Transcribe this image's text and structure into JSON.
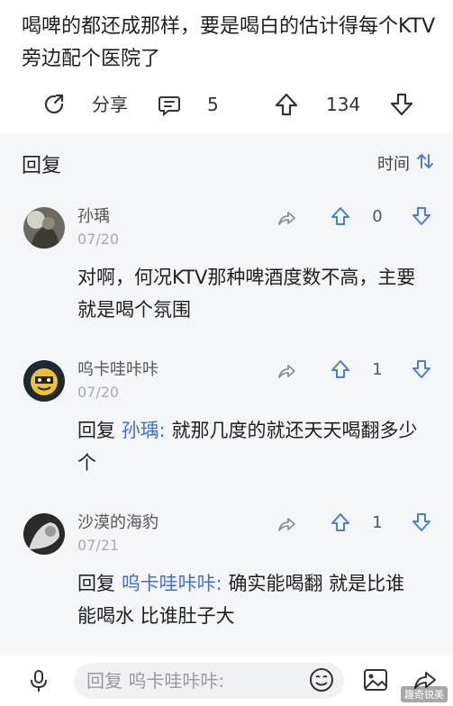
{
  "post": {
    "text": "喝啤的都还成那样，要是喝白的估计得每个KTV旁边配个医院了"
  },
  "actions": {
    "share_label": "分享",
    "comment_count": "5",
    "like_count": "134"
  },
  "replies": {
    "header": "回复",
    "sort_label": "时间",
    "items": [
      {
        "name": "孙瑀",
        "date": "07/20",
        "reply_prefix": "",
        "mention": "",
        "body": "对啊，何况KTV那种啤酒度数不高，主要就是喝个氛围",
        "likes": "0"
      },
      {
        "name": "呜卡哇咔咔",
        "date": "07/20",
        "reply_prefix": "回复 ",
        "mention": "孙瑀:",
        "body": " 就那几度的就还天天喝翻多少个",
        "likes": "1"
      },
      {
        "name": "沙漠的海豹",
        "date": "07/21",
        "reply_prefix": "回复 ",
        "mention": "呜卡哇咔咔:",
        "body": " 确实能喝翻 就是比谁能喝水 比谁肚子大",
        "likes": "1"
      }
    ]
  },
  "input": {
    "placeholder": "回复 呜卡哇咔咔:"
  },
  "watermark": "趣奇锐美",
  "colors": {
    "mention": "#3d6fd8",
    "panel_bg": "#f4f5f7",
    "icon_blue": "#4a7fd6"
  }
}
